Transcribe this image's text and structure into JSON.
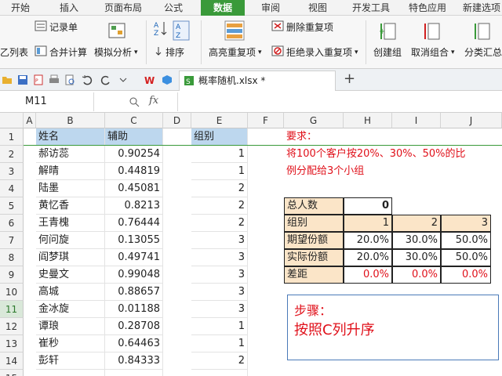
{
  "ribbon_tabs": [
    "开始",
    "插入",
    "页面布局",
    "公式",
    "数据",
    "审阅",
    "视图",
    "开发工具",
    "特色应用",
    "新建选项"
  ],
  "active_tab": "数据",
  "ribbon_buttons": {
    "record_form": "记录单",
    "consolidate": "合并计算",
    "what_if": "模拟分析",
    "sort": "排序",
    "highlight_dup": "高亮重复项",
    "remove_dup": "删除重复项",
    "reject_dup": "拒绝录入重复项",
    "group": "创建组",
    "ungroup": "取消组合",
    "subtotal": "分类汇总",
    "list_partial": "乙列表"
  },
  "file_tab": {
    "name": "概率随机.xlsx *",
    "new_tab": "+"
  },
  "formula_bar": {
    "name_box": "M11",
    "fx": "fx",
    "formula": ""
  },
  "column_headers": [
    "A",
    "B",
    "C",
    "D",
    "E",
    "F",
    "G",
    "H",
    "I",
    "J"
  ],
  "row_headers": [
    "1",
    "2",
    "3",
    "4",
    "5",
    "6",
    "7",
    "8",
    "9",
    "10",
    "11",
    "12",
    "13",
    "14",
    "15"
  ],
  "selected_row": "11",
  "table": {
    "col_b_header": "姓名",
    "col_c_header": "辅助",
    "col_e_header": "组别",
    "rows": [
      {
        "name": "郝访蕊",
        "aux": "0.90254",
        "group": "1"
      },
      {
        "name": "解晴",
        "aux": "0.44819",
        "group": "1"
      },
      {
        "name": "陆墨",
        "aux": "0.45081",
        "group": "2"
      },
      {
        "name": "黄忆香",
        "aux": "0.8213",
        "group": "2"
      },
      {
        "name": "王青槐",
        "aux": "0.76444",
        "group": "2"
      },
      {
        "name": "何问旋",
        "aux": "0.13055",
        "group": "3"
      },
      {
        "name": "阎梦琪",
        "aux": "0.49741",
        "group": "3"
      },
      {
        "name": "史曼文",
        "aux": "0.99048",
        "group": "3"
      },
      {
        "name": "高城",
        "aux": "0.88657",
        "group": "3"
      },
      {
        "name": "金冰旋",
        "aux": "0.01188",
        "group": "3"
      },
      {
        "name": "谭琅",
        "aux": "0.28708",
        "group": "1"
      },
      {
        "name": "崔秒",
        "aux": "0.64463",
        "group": "1"
      },
      {
        "name": "彭轩",
        "aux": "0.84333",
        "group": "2"
      },
      {
        "name": "",
        "aux": "",
        "group": ""
      }
    ]
  },
  "requirement": {
    "title": "要求：",
    "line1": "将100个客户按20%、30%、50%的比",
    "line2": "例分配给3个小组"
  },
  "summary": {
    "total_label": "总人数",
    "total_value": "0",
    "group_label": "组别",
    "groups": [
      "1",
      "2",
      "3"
    ],
    "expected_label": "期望份额",
    "expected": [
      "20.0%",
      "30.0%",
      "50.0%"
    ],
    "actual_label": "实际份额",
    "actual": [
      "20.0%",
      "30.0%",
      "50.0%"
    ],
    "diff_label": "差距",
    "diff": [
      "0.0%",
      "0.0%",
      "0.0%"
    ]
  },
  "step_box": {
    "title": "步骤：",
    "text": "按照C列升序"
  },
  "colors": {
    "accent": "#3a9a3a",
    "header_blue": "#bdd7ee",
    "tan": "#fbe5c8",
    "red": "#e0101a"
  }
}
